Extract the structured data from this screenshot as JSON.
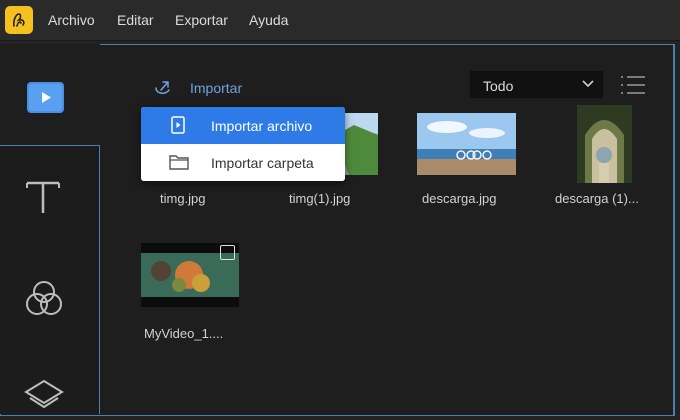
{
  "menubar": {
    "items": [
      "Archivo",
      "Editar",
      "Exportar",
      "Ayuda"
    ]
  },
  "toolbar": {
    "import_label": "Importar",
    "filter_value": "Todo"
  },
  "import_menu": {
    "items": [
      "Importar archivo",
      "Importar carpeta"
    ]
  },
  "media": [
    {
      "name": "timg.jpg"
    },
    {
      "name": "timg(1).jpg"
    },
    {
      "name": "descarga.jpg"
    },
    {
      "name": "descarga (1)..."
    },
    {
      "name": "MyVideo_1...."
    }
  ],
  "colors": {
    "accent": "#2e7be8",
    "frame_border": "#4a7fb0",
    "logo": "#f4c11e"
  },
  "icons": {
    "logo": "app-logo-icon",
    "sidebar": [
      "media-icon",
      "text-icon",
      "filters-icon",
      "layers-icon"
    ]
  }
}
